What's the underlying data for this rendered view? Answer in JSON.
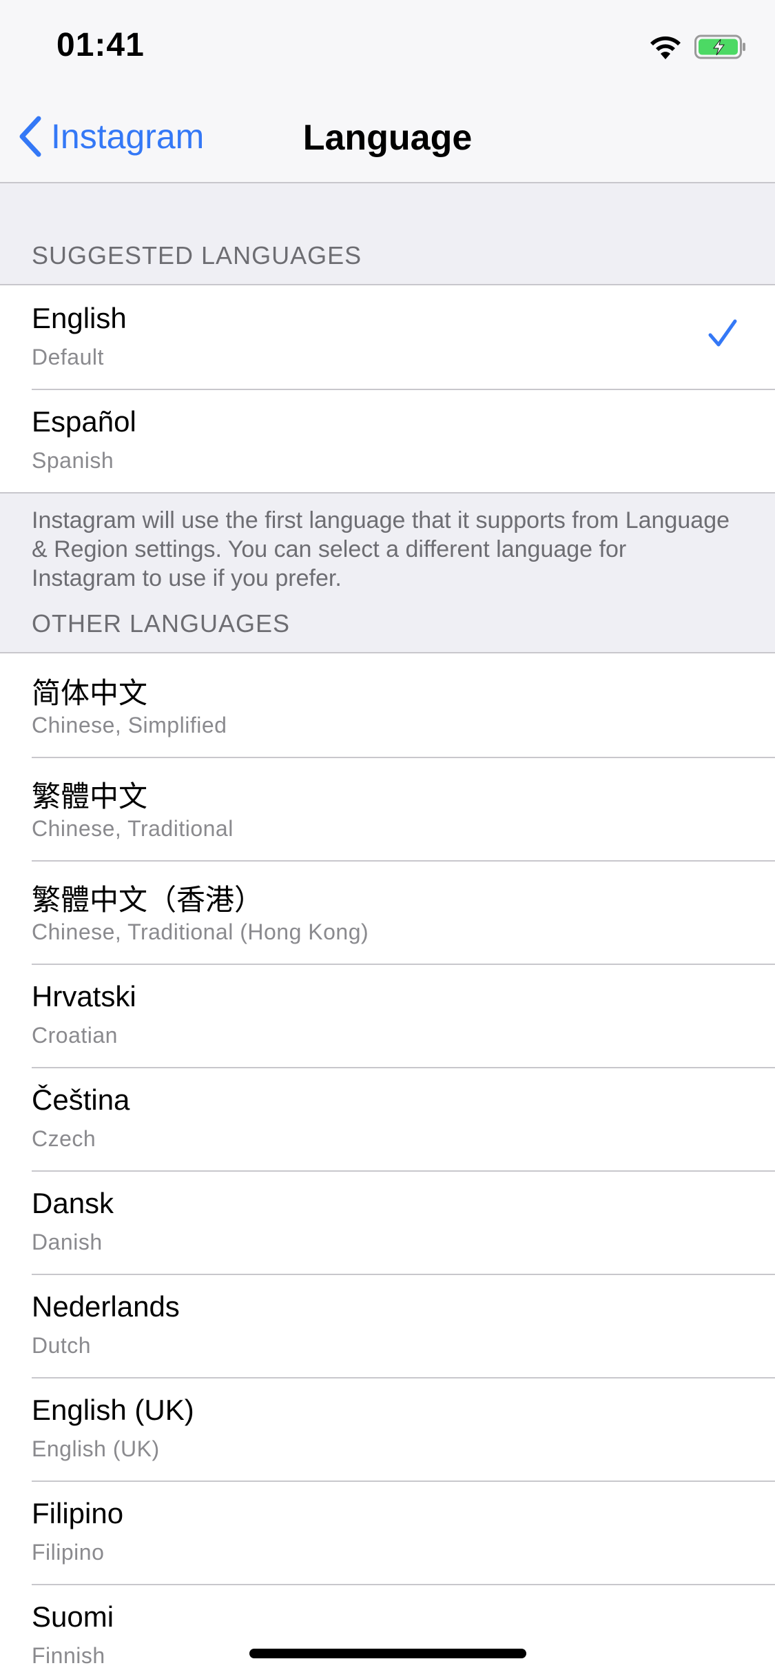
{
  "status_bar": {
    "time": "01:41",
    "wifi_icon": "wifi-icon",
    "battery_icon": "battery-charging-icon",
    "battery_color": "#4cd964"
  },
  "nav": {
    "back_label": "Instagram",
    "title": "Language",
    "accent_color": "#3478f6"
  },
  "suggested": {
    "header": "SUGGESTED LANGUAGES",
    "items": [
      {
        "name": "English",
        "subtitle": "Default",
        "selected": true
      },
      {
        "name": "Español",
        "subtitle": "Spanish",
        "selected": false
      }
    ],
    "footer": "Instagram will use the first language that it supports from Language & Region settings. You can select a different language for Instagram to use if you prefer."
  },
  "other": {
    "header": "OTHER LANGUAGES",
    "items": [
      {
        "name": "简体中文",
        "subtitle": "Chinese, Simplified"
      },
      {
        "name": "繁體中文",
        "subtitle": "Chinese, Traditional"
      },
      {
        "name": "繁體中文（香港）",
        "subtitle": "Chinese, Traditional (Hong Kong)"
      },
      {
        "name": "Hrvatski",
        "subtitle": "Croatian"
      },
      {
        "name": "Čeština",
        "subtitle": "Czech"
      },
      {
        "name": "Dansk",
        "subtitle": "Danish"
      },
      {
        "name": "Nederlands",
        "subtitle": "Dutch"
      },
      {
        "name": "English (UK)",
        "subtitle": "English (UK)"
      },
      {
        "name": "Filipino",
        "subtitle": "Filipino"
      },
      {
        "name": "Suomi",
        "subtitle": "Finnish"
      }
    ]
  }
}
